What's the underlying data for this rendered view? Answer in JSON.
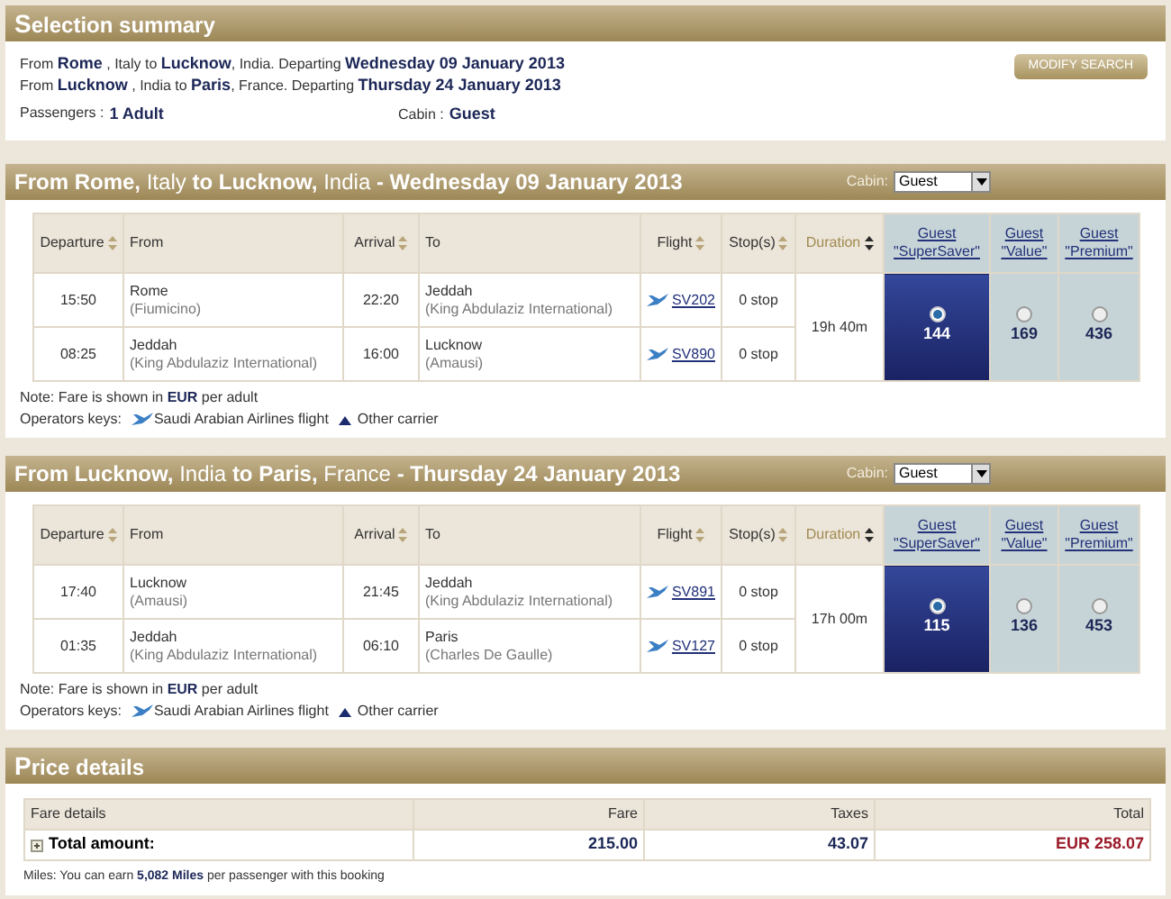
{
  "summary": {
    "title": "Selection summary",
    "routes": [
      "From **Rome** , Italy to **Lucknow**, India. Departing **Wednesday 09 January 2013**",
      "From **Lucknow** , India to **Paris**, France. Departing **Thursday 24 January 2013**"
    ],
    "modify_button": "MODIFY SEARCH",
    "passengers_label": "Passengers :",
    "passengers_value": "1 Adult",
    "cabin_label": "Cabin :",
    "cabin_value": "Guest"
  },
  "legs": [
    {
      "title": "**From Rome,** Italy **to Lucknow,** India **- Wednesday 09 January 2013**",
      "cabin_label": "Cabin:",
      "cabin_value": "Guest",
      "columns": [
        {
          "label": "Departure",
          "sortable": true,
          "sorted": false
        },
        {
          "label": "From",
          "sortable": false,
          "sorted": false
        },
        {
          "label": "Arrival",
          "sortable": true,
          "sorted": false
        },
        {
          "label": "To",
          "sortable": false,
          "sorted": false
        },
        {
          "label": "Flight",
          "sortable": true,
          "sorted": false
        },
        {
          "label": "Stop(s)",
          "sortable": true,
          "sorted": false
        },
        {
          "label": "Duration",
          "sortable": true,
          "sorted": true
        }
      ],
      "fare_columns": [
        {
          "line1": "Guest",
          "line2": "\"SuperSaver\""
        },
        {
          "line1": "Guest",
          "line2": "\"Value\""
        },
        {
          "line1": "Guest",
          "line2": "\"Premium\""
        }
      ],
      "segments": [
        {
          "departure": "15:50",
          "from": "Rome",
          "from_detail": "(Fiumicino)",
          "arrival": "22:20",
          "to": "Jeddah",
          "to_detail": "(King Abdulaziz International)",
          "flight": "SV202",
          "stops": "0 stop"
        },
        {
          "departure": "08:25",
          "from": "Jeddah",
          "from_detail": "(King Abdulaziz International)",
          "arrival": "16:00",
          "to": "Lucknow",
          "to_detail": "(Amausi)",
          "flight": "SV890",
          "stops": "0 stop"
        }
      ],
      "duration": "19h 40m",
      "fares": [
        {
          "price": "144",
          "selected": true
        },
        {
          "price": "169",
          "selected": false
        },
        {
          "price": "436",
          "selected": false
        }
      ],
      "note": "Note:  Fare is shown in **EUR** per adult",
      "keys_label": "Operators keys:",
      "keys": [
        {
          "kind": "saudi",
          "label": "Saudi Arabian Airlines flight"
        },
        {
          "kind": "other",
          "label": "Other carrier"
        }
      ]
    },
    {
      "title": "**From Lucknow,** India **to Paris,** France **- Thursday 24 January 2013**",
      "cabin_label": "Cabin:",
      "cabin_value": "Guest",
      "columns": [
        {
          "label": "Departure",
          "sortable": true,
          "sorted": false
        },
        {
          "label": "From",
          "sortable": false,
          "sorted": false
        },
        {
          "label": "Arrival",
          "sortable": true,
          "sorted": false
        },
        {
          "label": "To",
          "sortable": false,
          "sorted": false
        },
        {
          "label": "Flight",
          "sortable": true,
          "sorted": false
        },
        {
          "label": "Stop(s)",
          "sortable": true,
          "sorted": false
        },
        {
          "label": "Duration",
          "sortable": true,
          "sorted": true
        }
      ],
      "fare_columns": [
        {
          "line1": "Guest",
          "line2": "\"SuperSaver\""
        },
        {
          "line1": "Guest",
          "line2": "\"Value\""
        },
        {
          "line1": "Guest",
          "line2": "\"Premium\""
        }
      ],
      "segments": [
        {
          "departure": "17:40",
          "from": "Lucknow",
          "from_detail": "(Amausi)",
          "arrival": "21:45",
          "to": "Jeddah",
          "to_detail": "(King Abdulaziz International)",
          "flight": "SV891",
          "stops": "0 stop"
        },
        {
          "departure": "01:35",
          "from": "Jeddah",
          "from_detail": "(King Abdulaziz International)",
          "arrival": "06:10",
          "to": "Paris",
          "to_detail": "(Charles De Gaulle)",
          "flight": "SV127",
          "stops": "0 stop"
        }
      ],
      "duration": "17h 00m",
      "fares": [
        {
          "price": "115",
          "selected": true
        },
        {
          "price": "136",
          "selected": false
        },
        {
          "price": "453",
          "selected": false
        }
      ],
      "note": "Note:  Fare is shown in **EUR** per adult",
      "keys_label": "Operators keys:",
      "keys": [
        {
          "kind": "saudi",
          "label": "Saudi Arabian Airlines flight"
        },
        {
          "kind": "other",
          "label": "Other carrier"
        }
      ]
    }
  ],
  "price": {
    "title": "Price details",
    "columns": [
      "Fare details",
      "Fare",
      "Taxes",
      "Total"
    ],
    "row": {
      "label": "Total amount:",
      "fare": "215.00",
      "taxes": "43.07",
      "total": "EUR 258.07"
    },
    "miles": "Miles:  You can earn **5,082 Miles** per passenger with this booking"
  }
}
